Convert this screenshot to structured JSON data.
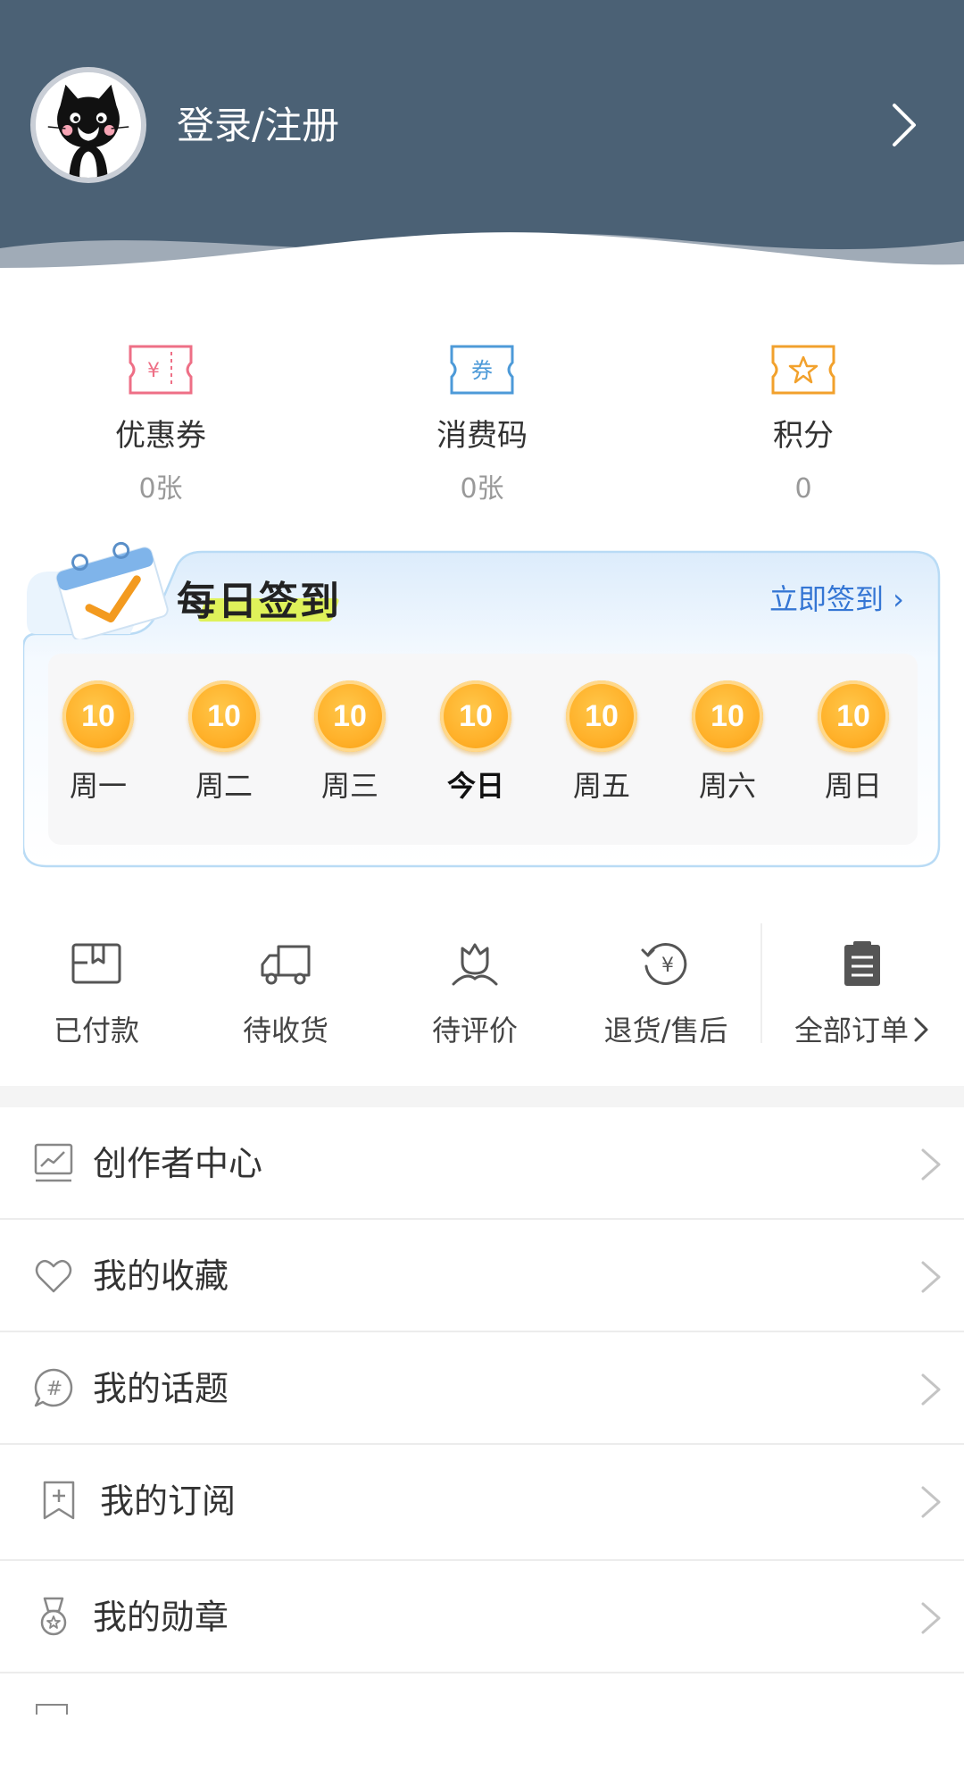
{
  "header": {
    "login_label": "登录/注册"
  },
  "stats": [
    {
      "label": "优惠券",
      "value": "0张",
      "icon": "coupon-yen-icon",
      "icon_text": "¥",
      "color": "#ee6f86"
    },
    {
      "label": "消费码",
      "value": "0张",
      "icon": "voucher-code-icon",
      "icon_text": "券",
      "color": "#4d9ad8"
    },
    {
      "label": "积分",
      "value": "0",
      "icon": "points-star-icon",
      "color": "#f2a12c"
    }
  ],
  "signin": {
    "title": "每日签到",
    "action": "立即签到 ›",
    "days": [
      {
        "coin": "10",
        "label": "周一",
        "today": false
      },
      {
        "coin": "10",
        "label": "周二",
        "today": false
      },
      {
        "coin": "10",
        "label": "周三",
        "today": false
      },
      {
        "coin": "10",
        "label": "今日",
        "today": true
      },
      {
        "coin": "10",
        "label": "周五",
        "today": false
      },
      {
        "coin": "10",
        "label": "周六",
        "today": false
      },
      {
        "coin": "10",
        "label": "周日",
        "today": false
      }
    ]
  },
  "orders": [
    {
      "label": "已付款",
      "icon": "package-icon"
    },
    {
      "label": "待收货",
      "icon": "truck-icon"
    },
    {
      "label": "待评价",
      "icon": "flower-icon"
    },
    {
      "label": "退货/售后",
      "icon": "refund-yen-icon"
    },
    {
      "label": "全部订单",
      "icon": "clipboard-icon"
    }
  ],
  "menu": [
    {
      "label": "创作者中心",
      "icon": "creator-chart-icon"
    },
    {
      "label": "我的收藏",
      "icon": "heart-icon"
    },
    {
      "label": "我的话题",
      "icon": "hashtag-chat-icon"
    },
    {
      "label": "我的订阅",
      "icon": "bookmark-plus-icon"
    },
    {
      "label": "我的勋章",
      "icon": "medal-icon"
    }
  ],
  "colors": {
    "header_bg": "#4b6175",
    "accent_blue": "#3576d4",
    "coin": "#ffb12a"
  }
}
